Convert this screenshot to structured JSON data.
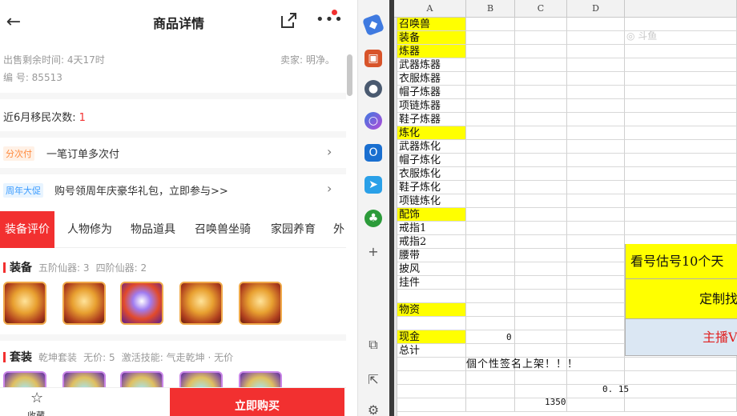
{
  "mobile": {
    "title": "商品详情",
    "back_icon": "←",
    "more_icon": "•••",
    "meta": {
      "time_left": "出售剩余时间: 4天17时",
      "seller": "卖家: 明净。",
      "serial": "编 号: 85513"
    },
    "migrate": {
      "label": "近6月移民次数:",
      "count": "1"
    },
    "installment": {
      "badge": "分次付",
      "text": "一笔订单多次付",
      "chevron": "›"
    },
    "promo": {
      "badge": "周年大促",
      "text": "购号领周年庆豪华礼包，立即参与>>",
      "chevron": "›"
    },
    "tabs": [
      "装备评价",
      "人物修为",
      "物品道具",
      "召唤兽坐骑",
      "家园养育",
      "外"
    ],
    "equip_section": {
      "title": "装备",
      "detail1": "五阶仙器: 3",
      "detail2": "四阶仙器: 2"
    },
    "set_section": {
      "title": "套装",
      "detail1": "乾坤套装",
      "detail2": "无价: 5",
      "detail3": "激活技能: 气走乾坤 · 无价"
    },
    "bottom": {
      "fav_label": "收藏",
      "buy_label": "立即购买"
    },
    "colors": {
      "accent": "#f23030"
    }
  },
  "edge_sidebar": {
    "icons": [
      "tag-icon",
      "briefcase-icon",
      "people-icon",
      "copilot-icon",
      "outlook-icon",
      "send-icon",
      "tree-icon",
      "plus-icon",
      "screenshot-icon",
      "open-external-icon",
      "settings-icon"
    ],
    "plus": "+",
    "screenshot": "⧉",
    "external": "⇱",
    "settings": "⚙"
  },
  "sheet": {
    "columns": [
      "A",
      "B",
      "C",
      "D"
    ],
    "rows": [
      {
        "label": "召唤兽",
        "yellow": true
      },
      {
        "label": "装备",
        "yellow": true
      },
      {
        "label": "炼器",
        "yellow": true
      },
      {
        "label": "武器炼器",
        "yellow": false
      },
      {
        "label": "衣服炼器",
        "yellow": false
      },
      {
        "label": "帽子炼器",
        "yellow": false
      },
      {
        "label": "项链炼器",
        "yellow": false
      },
      {
        "label": "鞋子炼器",
        "yellow": false
      },
      {
        "label": "炼化",
        "yellow": true
      },
      {
        "label": "武器炼化",
        "yellow": false
      },
      {
        "label": "帽子炼化",
        "yellow": false
      },
      {
        "label": "衣服炼化",
        "yellow": false
      },
      {
        "label": "鞋子炼化",
        "yellow": false
      },
      {
        "label": "项链炼化",
        "yellow": false
      },
      {
        "label": "配饰",
        "yellow": true
      },
      {
        "label": "戒指1",
        "yellow": false
      },
      {
        "label": "戒指2",
        "yellow": false
      },
      {
        "label": "腰带",
        "yellow": false
      },
      {
        "label": "披风",
        "yellow": false
      },
      {
        "label": "挂件",
        "yellow": false
      },
      {
        "label": "",
        "yellow": false
      },
      {
        "label": "物资",
        "yellow": true
      },
      {
        "label": "",
        "yellow": false
      },
      {
        "label": "现金",
        "yellow": true
      },
      {
        "label": "总计",
        "yellow": false
      }
    ],
    "total_value": "0",
    "box1": "看号估号10个天",
    "box2": "定制找",
    "box3": "主播V",
    "marquee": "個个性签名上架！！！",
    "value_d": "0. 15",
    "value_c": "1350",
    "watermark": "◎ 斗鱼"
  }
}
